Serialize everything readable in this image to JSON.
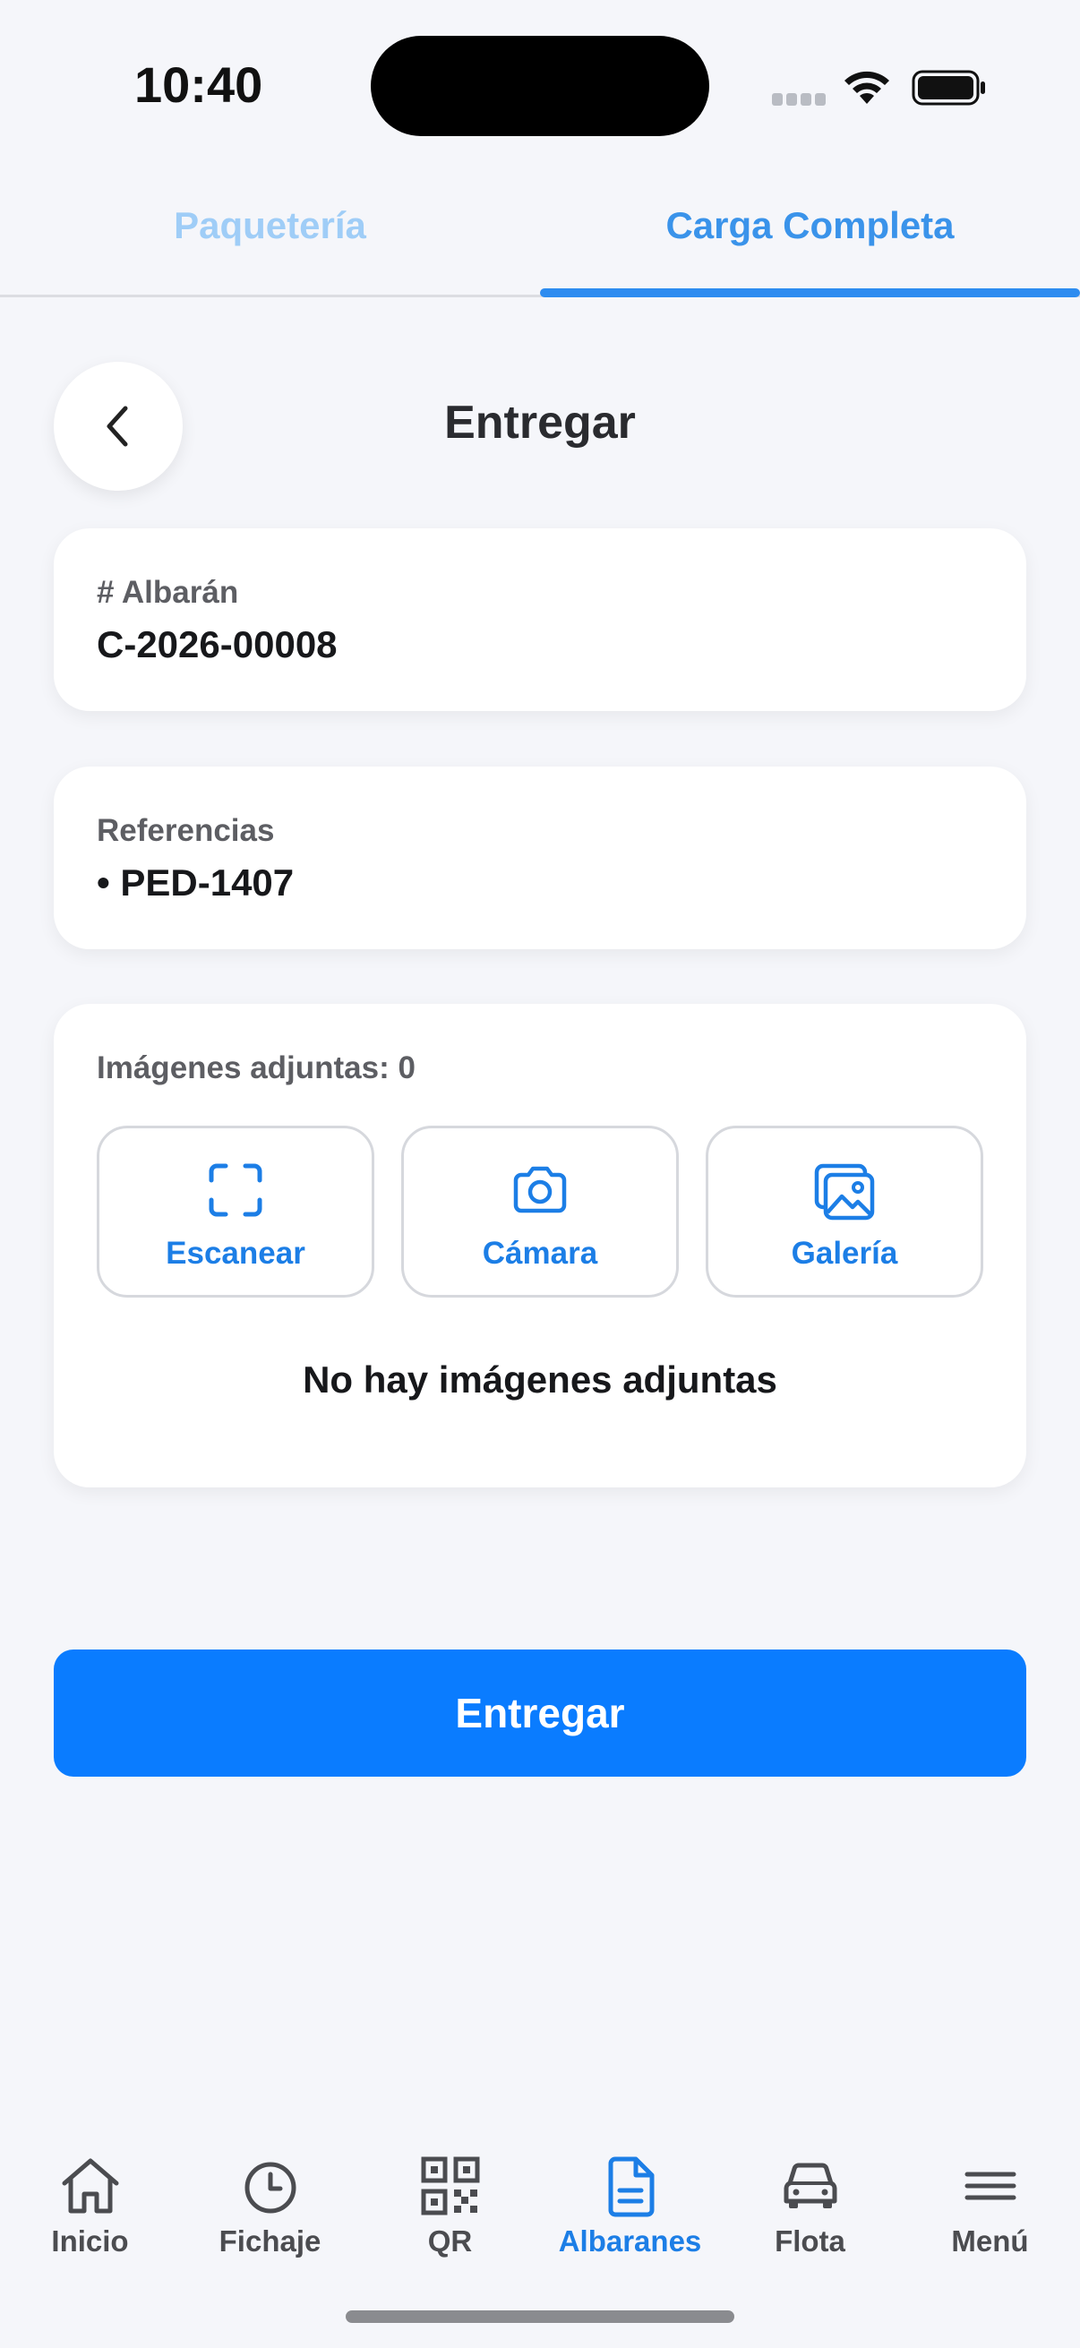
{
  "status_bar": {
    "time": "10:40"
  },
  "tabs": [
    {
      "label": "Paquetería",
      "active": false
    },
    {
      "label": "Carga Completa",
      "active": true
    }
  ],
  "header": {
    "title": "Entregar"
  },
  "albaran": {
    "label": "# Albarán",
    "value": "C-2026-00008"
  },
  "referencias": {
    "label": "Referencias",
    "items": [
      "• PED-1407"
    ]
  },
  "attachments": {
    "label": "Imágenes adjuntas: 0",
    "buttons": [
      {
        "label": "Escanear",
        "icon": "scan-icon"
      },
      {
        "label": "Cámara",
        "icon": "camera-icon"
      },
      {
        "label": "Galería",
        "icon": "gallery-icon"
      }
    ],
    "empty_text": "No hay imágenes adjuntas"
  },
  "primary_button": {
    "label": "Entregar"
  },
  "bottom_nav": [
    {
      "label": "Inicio",
      "icon": "home-icon",
      "active": false
    },
    {
      "label": "Fichaje",
      "icon": "clock-icon",
      "active": false
    },
    {
      "label": "QR",
      "icon": "qr-icon",
      "active": false
    },
    {
      "label": "Albaranes",
      "icon": "document-icon",
      "active": true
    },
    {
      "label": "Flota",
      "icon": "car-icon",
      "active": false
    },
    {
      "label": "Menú",
      "icon": "menu-icon",
      "active": false
    }
  ],
  "colors": {
    "accent": "#0a7cff",
    "active_tab": "#3a93ea",
    "inactive_tab": "#9fcdf7",
    "background": "#f5f6fa"
  }
}
